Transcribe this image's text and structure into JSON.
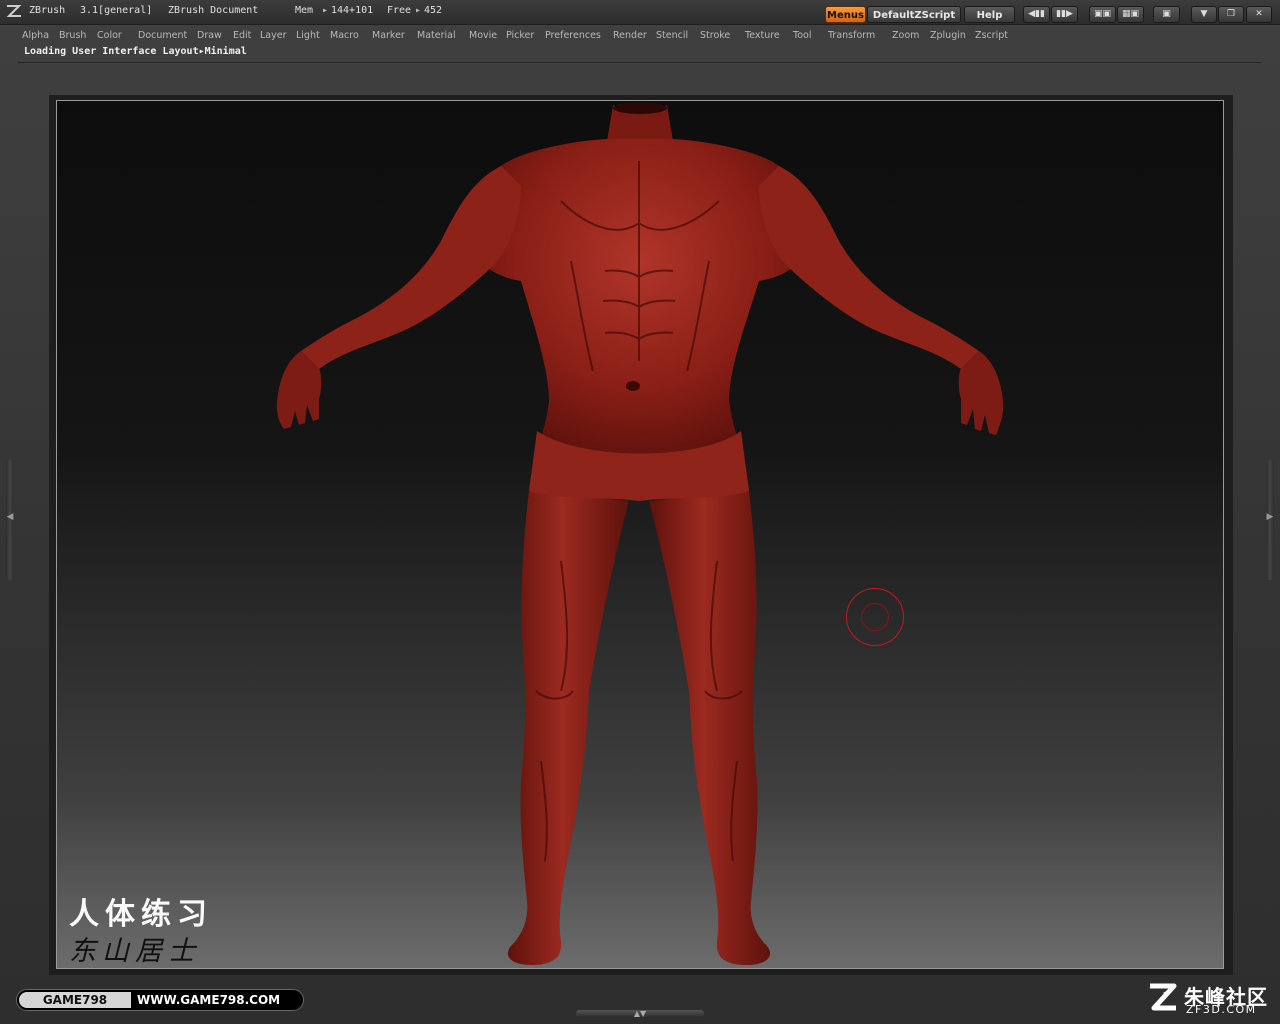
{
  "app": {
    "name": "ZBrush",
    "version": "3.1[general]",
    "document": "ZBrush Document",
    "mem_label": "Mem",
    "mem_value": "144+101",
    "free_label": "Free",
    "free_value": "452"
  },
  "toolbar": {
    "menus_label": "Menus",
    "script_label": "DefaultZScript",
    "help_label": "Help"
  },
  "menu": {
    "items": [
      "Alpha",
      "Brush",
      "Color",
      "Document",
      "Draw",
      "Edit",
      "Layer",
      "Light",
      "Macro",
      "Marker",
      "Material",
      "Movie",
      "Picker",
      "Preferences",
      "Render",
      "Stencil",
      "Stroke",
      "Texture",
      "Tool",
      "Transform",
      "Zoom",
      "Zplugin",
      "Zscript"
    ]
  },
  "status": {
    "text": "Loading User Interface Layout▸Minimal"
  },
  "watermark": {
    "line1": "人体练习",
    "line2": "东山居士"
  },
  "footer": {
    "badge_left": "GAME798",
    "badge_right": "WWW.GAME798.COM",
    "brand_cn": "朱峰社区",
    "brand_en": "ZF3D.COM"
  },
  "colors": {
    "accent": "#e8741a",
    "model": "#8a1f14",
    "cursor": "#c61a1a"
  }
}
